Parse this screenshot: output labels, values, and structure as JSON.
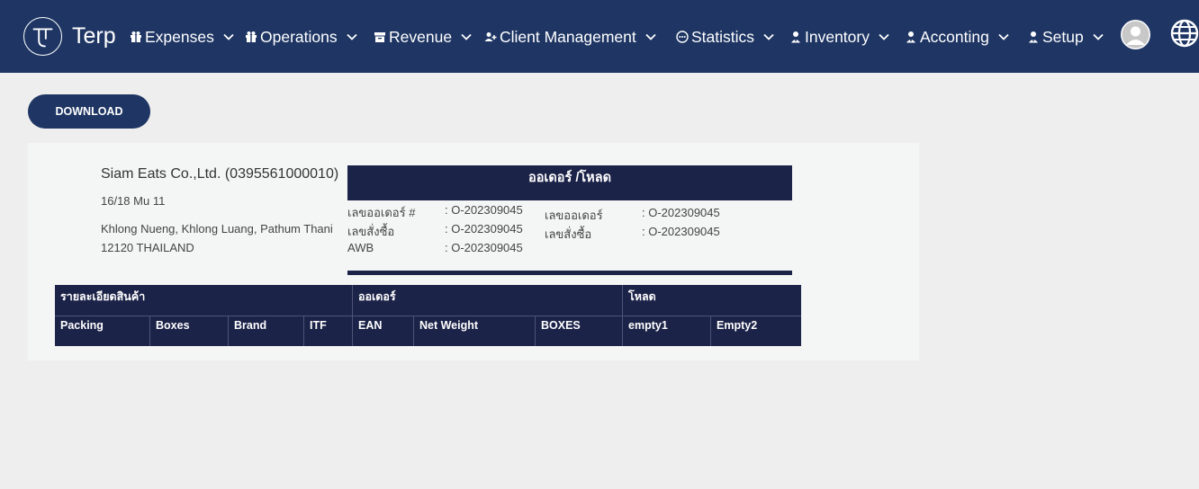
{
  "nav": {
    "brand": "Terp",
    "items": [
      {
        "label": "Expenses",
        "icon": "gift-icon"
      },
      {
        "label": "Operations",
        "icon": "gift-icon"
      },
      {
        "label": "Revenue",
        "icon": "archive-icon"
      },
      {
        "label": "Client Management",
        "icon": "user-plus-icon"
      },
      {
        "label": "Statistics",
        "icon": "dots-circle-icon"
      },
      {
        "label": "Inventory",
        "icon": "user-tie-icon"
      },
      {
        "label": "Acconting",
        "icon": "user-tie-icon"
      },
      {
        "label": "Setup",
        "icon": "user-tie-icon"
      }
    ]
  },
  "actions": {
    "download": "DOWNLOAD"
  },
  "company": {
    "name": "Siam Eats Co.,Ltd. (0395561000010)",
    "address1": "16/18 Mu 11",
    "address2": "Khlong Nueng, Khlong Luang, Pathum Thani",
    "address3": "12120 THAILAND"
  },
  "order": {
    "title": "ออเดอร์ /โหลด",
    "left": [
      {
        "label": "เลขออเดอร์ #",
        "value": ": O-202309045"
      },
      {
        "label": "เลขสั่งซื้อ",
        "value": ": O-202309045"
      },
      {
        "label": "AWB",
        "value": ": O-202309045"
      }
    ],
    "right": [
      {
        "label": "เลขออเดอร์",
        "value": ": O-202309045"
      },
      {
        "label": "เลขสั่งซื้อ",
        "value": ": O-202309045"
      }
    ]
  },
  "table": {
    "groups": [
      "รายละเอียดสินค้า",
      "ออเดอร์",
      "โหลด"
    ],
    "columns": [
      "Packing",
      "Boxes",
      "Brand",
      "ITF",
      "EAN",
      "Net Weight",
      "BOXES",
      "empty1",
      "Empty2"
    ]
  },
  "colors": {
    "navbar": "#1f3664",
    "header_dark": "#1c2348",
    "background": "#eeeeee",
    "panel": "#f4f6f6"
  }
}
